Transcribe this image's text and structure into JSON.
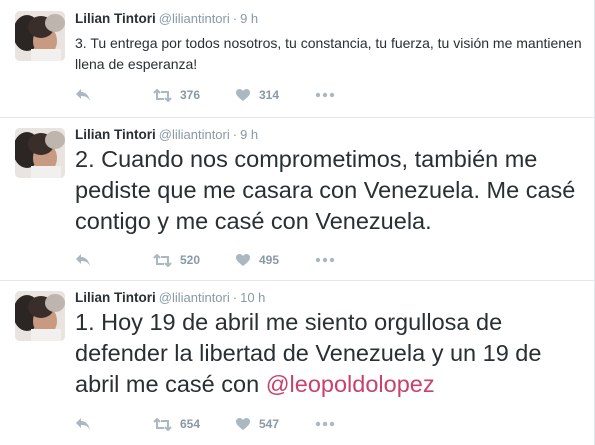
{
  "colors": {
    "mention": "#c8426a",
    "meta": "#8899a6",
    "text": "#292f33",
    "divider": "#e1e8ed"
  },
  "icons": {
    "reply": "reply-icon",
    "retweet": "retweet-icon",
    "like": "heart-icon",
    "more": "more-dots-icon"
  },
  "tweets": [
    {
      "fullname": "Lilian Tintori",
      "handle": "@liliantintori",
      "separator": "·",
      "time": "9 h",
      "text": "3. Tu entrega por todos nosotros, tu constancia, tu fuerza, tu visión me mantienen llena de esperanza!",
      "mention": "",
      "retweets": "376",
      "likes": "314"
    },
    {
      "fullname": "Lilian Tintori",
      "handle": "@liliantintori",
      "separator": "·",
      "time": "9 h",
      "text": "2. Cuando nos comprometimos, también me pediste que me casara con Venezuela. Me casé contigo y me casé con Venezuela.",
      "mention": "",
      "retweets": "520",
      "likes": "495"
    },
    {
      "fullname": "Lilian Tintori",
      "handle": "@liliantintori",
      "separator": "·",
      "time": "10 h",
      "text": "1. Hoy 19 de abril me siento orgullosa de defender la libertad de Venezuela y un 19 de abril me casé con ",
      "mention": "@leopoldolopez",
      "retweets": "654",
      "likes": "547"
    }
  ]
}
